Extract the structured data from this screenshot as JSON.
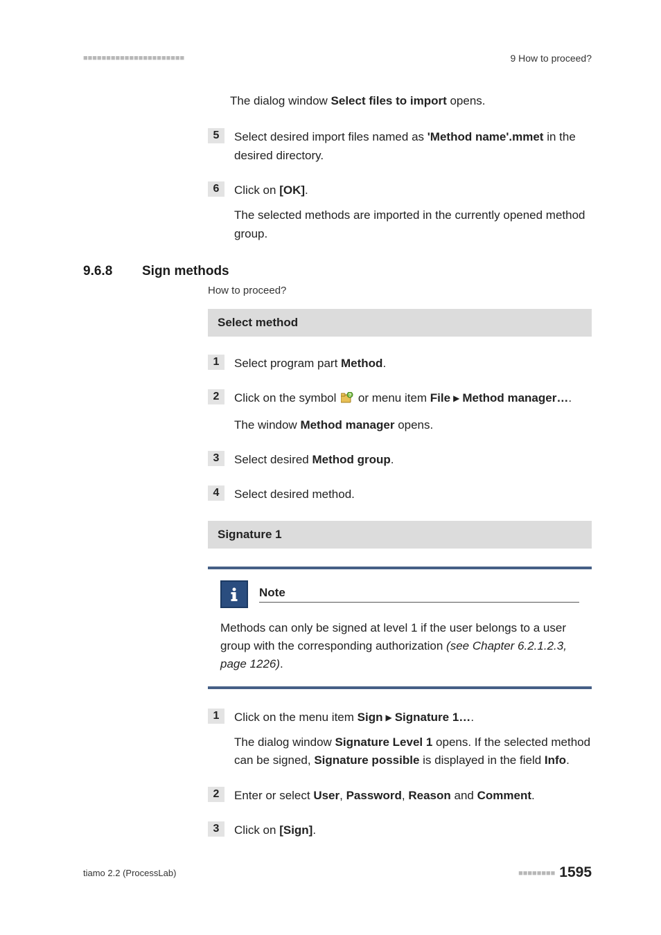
{
  "header": {
    "dashmarks": "■■■■■■■■■■■■■■■■■■■■■■",
    "right": "9 How to proceed?"
  },
  "intro": {
    "p1_a": "The dialog window ",
    "p1_b": "Select files to import",
    "p1_c": " opens."
  },
  "prev_steps": {
    "s5": {
      "num": "5",
      "a": "Select desired import files named as ",
      "b": "'Method name'.mmet",
      "c": " in the desired directory."
    },
    "s6": {
      "num": "6",
      "a": "Click on ",
      "b": "[OK]",
      "c": ".",
      "extra": "The selected methods are imported in the currently opened method group."
    }
  },
  "section": {
    "num": "9.6.8",
    "title": "Sign methods",
    "subtitle": "How to proceed?"
  },
  "bar1": "Select method",
  "sm_steps": {
    "s1": {
      "num": "1",
      "a": "Select program part ",
      "b": "Method",
      "c": "."
    },
    "s2": {
      "num": "2",
      "a": "Click on the symbol ",
      "b": " or menu item ",
      "c": "File",
      "d": "Method manager…",
      "e": ".",
      "extra_a": "The window ",
      "extra_b": "Method manager",
      "extra_c": " opens."
    },
    "s3": {
      "num": "3",
      "a": "Select desired ",
      "b": "Method group",
      "c": "."
    },
    "s4": {
      "num": "4",
      "a": "Select desired method."
    }
  },
  "bar2": "Signature 1",
  "note": {
    "title": "Note",
    "body_a": "Methods can only be signed at level 1 if the user belongs to a user group with the corresponding authorization ",
    "body_b": "(see Chapter 6.2.1.2.3, page 1226)",
    "body_c": "."
  },
  "sig_steps": {
    "s1": {
      "num": "1",
      "a": "Click on the menu item ",
      "b": "Sign",
      "c": "Signature 1…",
      "d": ".",
      "extra_a": "The dialog window ",
      "extra_b": "Signature Level 1",
      "extra_c": " opens. If the selected method can be signed, ",
      "extra_d": "Signature possible",
      "extra_e": " is displayed in the field ",
      "extra_f": "Info",
      "extra_g": "."
    },
    "s2": {
      "num": "2",
      "a": "Enter or select ",
      "b": "User",
      "c": ", ",
      "d": "Password",
      "e": ", ",
      "f": "Reason",
      "g": " and ",
      "h": "Comment",
      "i": "."
    },
    "s3": {
      "num": "3",
      "a": "Click on ",
      "b": "[Sign]",
      "c": "."
    }
  },
  "footer": {
    "left": "tiamo 2.2 (ProcessLab)",
    "dashes": "■■■■■■■■",
    "page": "1595"
  }
}
